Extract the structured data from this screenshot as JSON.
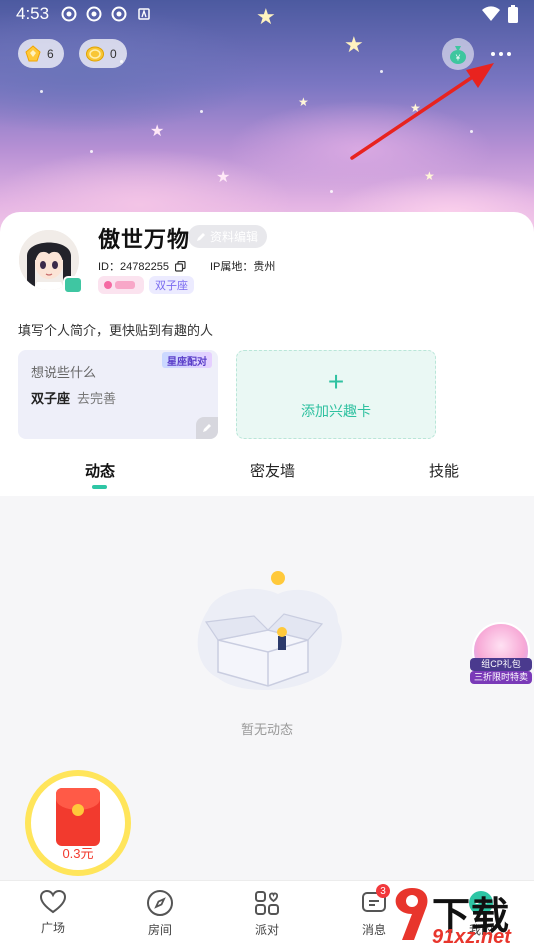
{
  "status_bar": {
    "time": "4:53"
  },
  "header": {
    "coin_1": "6",
    "coin_2": "0"
  },
  "profile": {
    "nickname": "傲世万物",
    "edit_label": "资料编辑",
    "id_label": "ID：24782255",
    "ip_label": "IP属地：贵州",
    "tag_zodiac": "双子座",
    "bio_placeholder": "填写个人简介，更快贴到有趣的人"
  },
  "cards": {
    "say_title": "想说些什么",
    "say_badge": "星座配对",
    "say_zodiac": "双子座",
    "say_action": "去完善",
    "add_interest": "添加兴趣卡"
  },
  "tabs": [
    "动态",
    "密友墙",
    "技能"
  ],
  "feed": {
    "empty_text": "暂无动态"
  },
  "float_gift": {
    "line1": "组CP礼包",
    "line2": "三折限时特卖"
  },
  "red_packet": {
    "amount": "0.3元"
  },
  "bottom_nav": {
    "items": [
      {
        "label": "广场",
        "icon": "heart-icon"
      },
      {
        "label": "房间",
        "icon": "compass-icon"
      },
      {
        "label": "派对",
        "icon": "party-icon"
      },
      {
        "label": "消息",
        "icon": "message-icon"
      },
      {
        "label": "我的",
        "icon": "profile-icon"
      }
    ],
    "message_badge": "3"
  },
  "watermark": {
    "title": "下载站",
    "url": "91xz.net"
  },
  "colors": {
    "accent": "#2ec6a5",
    "bio_text": "#333333",
    "badge": "#f2393c"
  }
}
